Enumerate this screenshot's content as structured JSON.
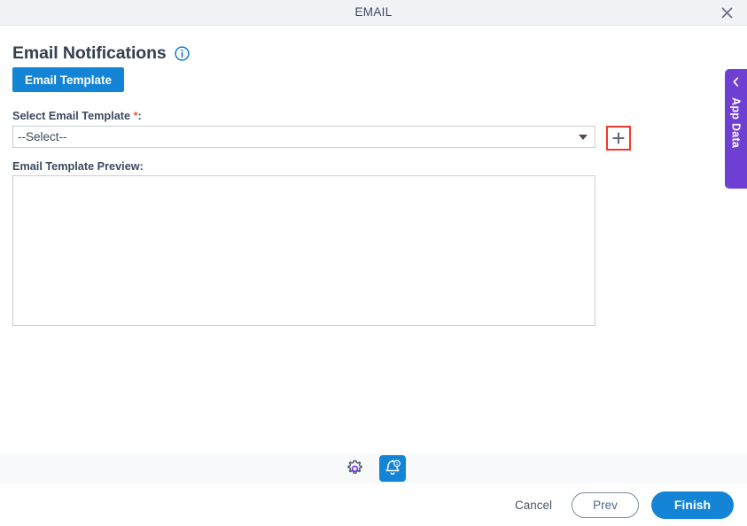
{
  "window": {
    "title": "EMAIL",
    "close_icon": "close-icon"
  },
  "page": {
    "heading": "Email Notifications",
    "info_icon": "info-icon",
    "section_tab_label": "Email Template"
  },
  "form": {
    "select_label": "Select Email Template",
    "select_required_marker": "*",
    "select_label_suffix": ":",
    "select_value": "--Select--",
    "select_placeholder": "--Select--",
    "select_options": [
      "--Select--"
    ],
    "dropdown_arrow_icon": "chevron-down-icon",
    "add_button_icon": "plus-icon",
    "add_button_highlight_color": "#f2392e",
    "preview_label": "Email Template Preview:",
    "preview_value": "",
    "preview_placeholder": ""
  },
  "side_panel": {
    "label": "App Data",
    "collapse_icon": "chevron-left-icon",
    "color": "#6f3fd4"
  },
  "toolbar": {
    "items": [
      {
        "name": "settings-icon",
        "label": "Settings",
        "active": false
      },
      {
        "name": "notifications-icon",
        "label": "Notifications",
        "active": true,
        "badge": "1"
      }
    ]
  },
  "footer": {
    "cancel_label": "Cancel",
    "prev_label": "Prev",
    "finish_label": "Finish"
  },
  "colors": {
    "accent_blue": "#1484d6",
    "purple": "#6f3fd4",
    "highlight_red": "#f2392e",
    "titlebar_bg": "#f1f2f6",
    "toolbar_bg": "#f8f9fb"
  }
}
